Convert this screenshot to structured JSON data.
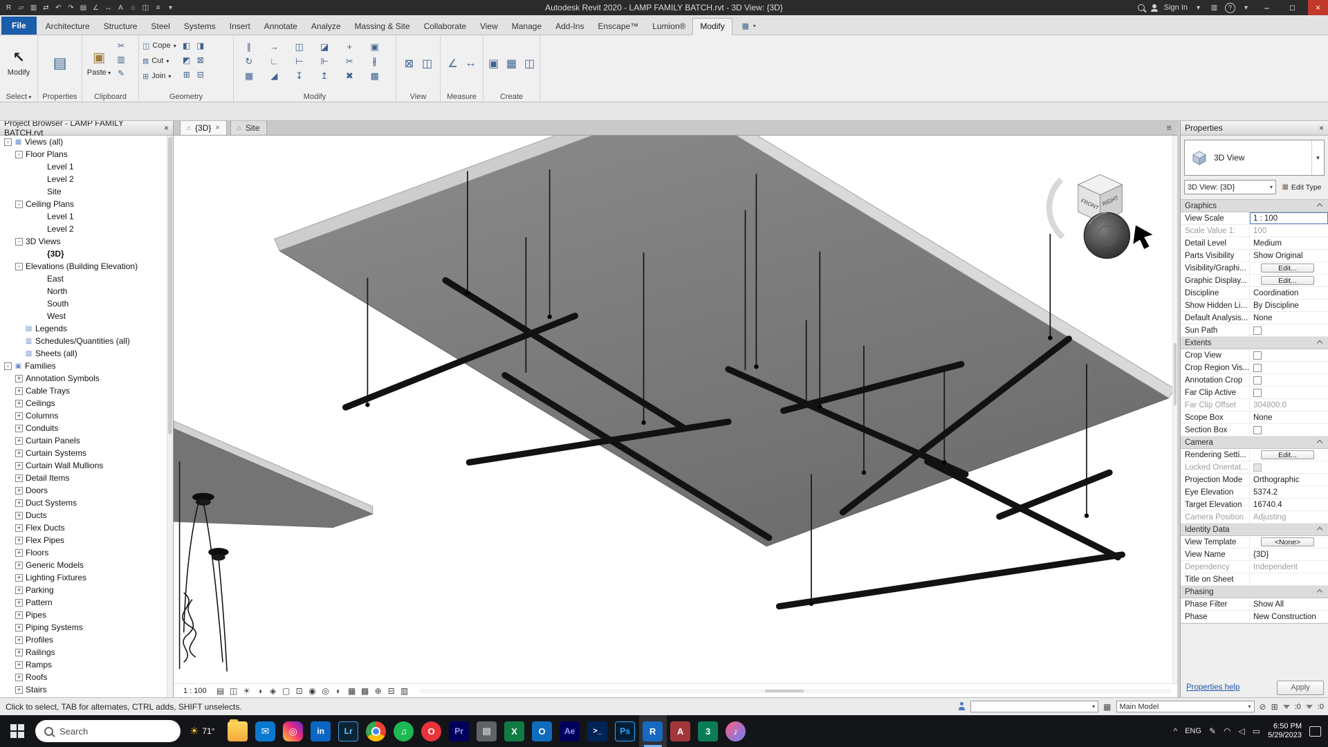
{
  "icons": {
    "caret_down": "▾",
    "caret_up": "^",
    "close": "×",
    "minimize": "–",
    "maximize": "□",
    "help": "?",
    "cursor": "↖",
    "properties_palette": "▤",
    "paste": "▣",
    "panel_image": "▦",
    "sun": "☀",
    "pen": "✎",
    "wifi": "◠",
    "volume": "◁",
    "battery": "▭",
    "list": "≡",
    "store": "▥",
    "tab_view": "⌂",
    "edit_type": "▦",
    "exclude": "⊘",
    "drag": "⊞"
  },
  "title_bar": {
    "title": "Autodesk Revit 2020 - LAMP FAMILY BATCH.rvt - 3D View: {3D}",
    "sign_in": "Sign In",
    "qat": [
      {
        "n": "revit-app-icon",
        "g": "R"
      },
      {
        "n": "open-icon",
        "g": "▱"
      },
      {
        "n": "save-icon",
        "g": "▥"
      },
      {
        "n": "sync-icon",
        "g": "⇄"
      },
      {
        "n": "undo-icon",
        "g": "↶"
      },
      {
        "n": "redo-icon",
        "g": "↷"
      },
      {
        "n": "print-icon",
        "g": "▤"
      },
      {
        "n": "measure-icon",
        "g": "∠"
      },
      {
        "n": "aligned-dimension-icon",
        "g": "↔"
      },
      {
        "n": "text-note-icon",
        "g": "A"
      },
      {
        "n": "default-3d-view-icon",
        "g": "⌂"
      },
      {
        "n": "section-icon",
        "g": "◫"
      },
      {
        "n": "thin-lines-icon",
        "g": "≡"
      },
      {
        "n": "qat-customize-icon",
        "g": "▾"
      }
    ]
  },
  "ribbon": {
    "tabs": [
      {
        "n": "tab-file",
        "label": "File",
        "cls": "file"
      },
      {
        "n": "tab-architecture",
        "label": "Architecture"
      },
      {
        "n": "tab-structure",
        "label": "Structure"
      },
      {
        "n": "tab-steel",
        "label": "Steel"
      },
      {
        "n": "tab-systems",
        "label": "Systems"
      },
      {
        "n": "tab-insert",
        "label": "Insert"
      },
      {
        "n": "tab-annotate",
        "label": "Annotate"
      },
      {
        "n": "tab-analyze",
        "label": "Analyze"
      },
      {
        "n": "tab-massing-site",
        "label": "Massing & Site"
      },
      {
        "n": "tab-collaborate",
        "label": "Collaborate"
      },
      {
        "n": "tab-view",
        "label": "View"
      },
      {
        "n": "tab-manage",
        "label": "Manage"
      },
      {
        "n": "tab-add-ins",
        "label": "Add-Ins"
      },
      {
        "n": "tab-enscape",
        "label": "Enscape™"
      },
      {
        "n": "tab-lumion",
        "label": "Lumion®"
      },
      {
        "n": "tab-modify",
        "label": "Modify",
        "cls": "active"
      }
    ],
    "panel_labels": {
      "select": "Select",
      "properties": "Properties",
      "clipboard": "Clipboard",
      "geometry": "Geometry",
      "modify": "Modify",
      "view": "View",
      "measure": "Measure",
      "create": "Create"
    },
    "big_buttons": {
      "modify": "Modify",
      "paste": "Paste"
    },
    "clipboard_icons": [
      {
        "n": "cut-to-clipboard-icon",
        "g": "✂"
      },
      {
        "n": "copy-to-clipboard-icon",
        "g": "▥"
      },
      {
        "n": "match-type-properties-icon",
        "g": "✎"
      }
    ],
    "geometry_buttons": [
      {
        "n": "cope-button",
        "label": "Cope",
        "g": "◫"
      },
      {
        "n": "cut-geometry-button",
        "label": "Cut",
        "g": "⊠"
      },
      {
        "n": "join-geometry-button",
        "label": "Join",
        "g": "⊞"
      }
    ],
    "geometry_icons": [
      {
        "n": "paint-icon",
        "g": "◧"
      },
      {
        "n": "remove-paint-icon",
        "g": "◨"
      },
      {
        "n": "split-face-icon",
        "g": "◩"
      },
      {
        "n": "demolish-icon",
        "g": "⊠"
      },
      {
        "n": "wall-joins-icon",
        "g": "⊞"
      },
      {
        "n": "beam-joins-icon",
        "g": "⊟"
      }
    ],
    "modify_icons": [
      {
        "n": "align-icon",
        "g": "∥"
      },
      {
        "n": "offset-icon",
        "g": "→"
      },
      {
        "n": "mirror-axis-icon",
        "g": "◫"
      },
      {
        "n": "mirror-pick-icon",
        "g": "◪"
      },
      {
        "n": "move-icon",
        "g": "+"
      },
      {
        "n": "copy-icon",
        "g": "▣"
      },
      {
        "n": "rotate-icon",
        "g": "↻"
      },
      {
        "n": "trim-corner-icon",
        "g": "∟"
      },
      {
        "n": "trim-single-icon",
        "g": "⊢"
      },
      {
        "n": "trim-multiple-icon",
        "g": "⊩"
      },
      {
        "n": "split-element-icon",
        "g": "✂"
      },
      {
        "n": "split-gap-icon",
        "g": "∦"
      },
      {
        "n": "array-icon",
        "g": "▦"
      },
      {
        "n": "scale-icon",
        "g": "◢"
      },
      {
        "n": "pin-icon",
        "g": "↧"
      },
      {
        "n": "unpin-icon",
        "g": "↥"
      },
      {
        "n": "delete-icon",
        "g": "✖"
      },
      {
        "n": "paste-aligned-icon",
        "g": "▩"
      }
    ],
    "view_icons": [
      {
        "n": "close-hidden-windows-icon",
        "g": "⊠"
      },
      {
        "n": "switch-windows-icon",
        "g": "◫"
      }
    ],
    "measure_icons": [
      {
        "n": "measure-length-icon",
        "g": "∠"
      },
      {
        "n": "dimension-icon",
        "g": "↔"
      }
    ],
    "create_icons": [
      {
        "n": "create-group-icon",
        "g": "▣"
      },
      {
        "n": "create-similar-icon",
        "g": "▦"
      },
      {
        "n": "create-assembly-icon",
        "g": "◫"
      }
    ]
  },
  "project_browser": {
    "title": "Project Browser - LAMP FAMILY BATCH.rvt",
    "tree": [
      {
        "label": "Views (all)",
        "cls": "lvl0",
        "exp": "-",
        "ico": "▦"
      },
      {
        "label": "Floor Plans",
        "cls": "lvl1",
        "exp": "-"
      },
      {
        "label": "Level 1",
        "cls": "leaf2"
      },
      {
        "label": "Level 2",
        "cls": "leaf2"
      },
      {
        "label": "Site",
        "cls": "leaf2"
      },
      {
        "label": "Ceiling Plans",
        "cls": "lvl1",
        "exp": "-"
      },
      {
        "label": "Level 1",
        "cls": "leaf2"
      },
      {
        "label": "Level 2",
        "cls": "leaf2"
      },
      {
        "label": "3D Views",
        "cls": "lvl1",
        "exp": "-"
      },
      {
        "label": "{3D}",
        "cls": "leaf2 bold"
      },
      {
        "label": "Elevations (Building Elevation)",
        "cls": "lvl1",
        "exp": "-"
      },
      {
        "label": "East",
        "cls": "leaf2"
      },
      {
        "label": "North",
        "cls": "leaf2"
      },
      {
        "label": "South",
        "cls": "leaf2"
      },
      {
        "label": "West",
        "cls": "leaf2"
      },
      {
        "label": "Legends",
        "cls": "lvl0i",
        "ico": "▤"
      },
      {
        "label": "Schedules/Quantities (all)",
        "cls": "lvl0i",
        "ico": "▥"
      },
      {
        "label": "Sheets (all)",
        "cls": "lvl0i",
        "ico": "▧"
      },
      {
        "label": "Families",
        "cls": "lvl0",
        "exp": "-",
        "ico": "▣"
      },
      {
        "label": "Annotation Symbols",
        "cls": "lvl1",
        "exp": "+"
      },
      {
        "label": "Cable Trays",
        "cls": "lvl1",
        "exp": "+"
      },
      {
        "label": "Ceilings",
        "cls": "lvl1",
        "exp": "+"
      },
      {
        "label": "Columns",
        "cls": "lvl1",
        "exp": "+"
      },
      {
        "label": "Conduits",
        "cls": "lvl1",
        "exp": "+"
      },
      {
        "label": "Curtain Panels",
        "cls": "lvl1",
        "exp": "+"
      },
      {
        "label": "Curtain Systems",
        "cls": "lvl1",
        "exp": "+"
      },
      {
        "label": "Curtain Wall Mullions",
        "cls": "lvl1",
        "exp": "+"
      },
      {
        "label": "Detail Items",
        "cls": "lvl1",
        "exp": "+"
      },
      {
        "label": "Doors",
        "cls": "lvl1",
        "exp": "+"
      },
      {
        "label": "Duct Systems",
        "cls": "lvl1",
        "exp": "+"
      },
      {
        "label": "Ducts",
        "cls": "lvl1",
        "exp": "+"
      },
      {
        "label": "Flex Ducts",
        "cls": "lvl1",
        "exp": "+"
      },
      {
        "label": "Flex Pipes",
        "cls": "lvl1",
        "exp": "+"
      },
      {
        "label": "Floors",
        "cls": "lvl1",
        "exp": "+"
      },
      {
        "label": "Generic Models",
        "cls": "lvl1",
        "exp": "+"
      },
      {
        "label": "Lighting Fixtures",
        "cls": "lvl1",
        "exp": "+"
      },
      {
        "label": "Parking",
        "cls": "lvl1",
        "exp": "+"
      },
      {
        "label": "Pattern",
        "cls": "lvl1",
        "exp": "+"
      },
      {
        "label": "Pipes",
        "cls": "lvl1",
        "exp": "+"
      },
      {
        "label": "Piping Systems",
        "cls": "lvl1",
        "exp": "+"
      },
      {
        "label": "Profiles",
        "cls": "lvl1",
        "exp": "+"
      },
      {
        "label": "Railings",
        "cls": "lvl1",
        "exp": "+"
      },
      {
        "label": "Ramps",
        "cls": "lvl1",
        "exp": "+"
      },
      {
        "label": "Roofs",
        "cls": "lvl1",
        "exp": "+"
      },
      {
        "label": "Stairs",
        "cls": "lvl1",
        "exp": "+"
      }
    ]
  },
  "view_tabs": [
    {
      "n": "view-tab-3d",
      "label": "{3D}",
      "cls": "active"
    },
    {
      "n": "view-tab-site",
      "label": "Site"
    }
  ],
  "viewport": {
    "scale": "1 : 100",
    "viewcube": {
      "front": "FRONT",
      "right": "RIGHT"
    },
    "control_icons": [
      {
        "n": "detail-level-icon",
        "g": "▤"
      },
      {
        "n": "visual-style-icon",
        "g": "◫"
      },
      {
        "n": "sun-path-icon",
        "g": "☀"
      },
      {
        "n": "shadows-icon",
        "g": "◑"
      },
      {
        "n": "rendering-dialog-icon",
        "g": "◈"
      },
      {
        "n": "crop-view-icon",
        "g": "▢"
      },
      {
        "n": "show-crop-region-icon",
        "g": "⊡"
      },
      {
        "n": "unlocked-view-icon",
        "g": "◉"
      },
      {
        "n": "temporary-hide-isolate-icon",
        "g": "◎"
      },
      {
        "n": "reveal-hidden-elements-icon",
        "g": "◐"
      },
      {
        "n": "temporary-view-properties-icon",
        "g": "▦"
      },
      {
        "n": "analytical-model-icon",
        "g": "▩"
      },
      {
        "n": "highlight-displacement-icon",
        "g": "⊕"
      },
      {
        "n": "reveal-constraints-icon",
        "g": "⊟"
      },
      {
        "n": "worksharing-display-icon",
        "g": "▥"
      }
    ]
  },
  "properties_panel": {
    "title": "Properties",
    "type_selector": "3D View",
    "instance_selector": "3D View: {3D}",
    "edit_type": "Edit Type",
    "rows": [
      {
        "label": "Graphics",
        "cls": "head"
      },
      {
        "label": "View Scale",
        "value": "1 : 100",
        "vcls": "sel"
      },
      {
        "label": "Scale Value  1:",
        "value": "100",
        "cls": "dim",
        "vcls": "gray"
      },
      {
        "label": "Detail Level",
        "value": "Medium"
      },
      {
        "label": "Parts Visibility",
        "value": "Show Original"
      },
      {
        "label": "Visibility/Graphi...",
        "value": "Edit...",
        "vcls": "btn"
      },
      {
        "label": "Graphic Display...",
        "value": "Edit...",
        "vcls": "btn"
      },
      {
        "label": "Discipline",
        "value": "Coordination"
      },
      {
        "label": "Show Hidden Li...",
        "value": "By Discipline"
      },
      {
        "label": "Default Analysis...",
        "value": "None"
      },
      {
        "label": "Sun Path",
        "value": "",
        "vcls": "chk"
      },
      {
        "label": "Extents",
        "cls": "head"
      },
      {
        "label": "Crop View",
        "value": "",
        "vcls": "chk"
      },
      {
        "label": "Crop Region Vis...",
        "value": "",
        "vcls": "chk"
      },
      {
        "label": "Annotation Crop",
        "value": "",
        "vcls": "chk"
      },
      {
        "label": "Far Clip Active",
        "value": "",
        "vcls": "chk"
      },
      {
        "label": "Far Clip Offset",
        "value": "304800.0",
        "cls": "dim",
        "vcls": "gray"
      },
      {
        "label": "Scope Box",
        "value": "None"
      },
      {
        "label": "Section Box",
        "value": "",
        "vcls": "chk"
      },
      {
        "label": "Camera",
        "cls": "head"
      },
      {
        "label": "Rendering Setti...",
        "value": "Edit...",
        "vcls": "btn"
      },
      {
        "label": "Locked Orientat...",
        "value": "",
        "cls": "dim",
        "vcls": "chkd"
      },
      {
        "label": "Projection Mode",
        "value": "Orthographic"
      },
      {
        "label": "Eye Elevation",
        "value": "5374.2"
      },
      {
        "label": "Target Elevation",
        "value": "16740.4"
      },
      {
        "label": "Camera Position",
        "value": "Adjusting",
        "cls": "dim",
        "vcls": "gray"
      },
      {
        "label": "Identity Data",
        "cls": "head"
      },
      {
        "label": "View Template",
        "value": "<None>",
        "vcls": "btn"
      },
      {
        "label": "View Name",
        "value": "{3D}"
      },
      {
        "label": "Dependency",
        "value": "Independent",
        "cls": "dim",
        "vcls": "gray"
      },
      {
        "label": "Title on Sheet",
        "value": ""
      },
      {
        "label": "Phasing",
        "cls": "head"
      },
      {
        "label": "Phase Filter",
        "value": "Show All"
      },
      {
        "label": "Phase",
        "value": "New Construction"
      }
    ],
    "help": "Properties help",
    "apply": "Apply"
  },
  "status_bar": {
    "hint": "Click to select, TAB for alternates, CTRL adds, SHIFT unselects.",
    "main_model": "Main Model",
    "count": ":0",
    "count2": ":0"
  },
  "taskbar": {
    "search_placeholder": "Search",
    "temperature": "71°",
    "lang": "ENG",
    "time": "6:50 PM",
    "date": "5/29/2023",
    "apps": [
      {
        "n": "file-explorer-icon",
        "cls": "a-folder",
        "g": ""
      },
      {
        "n": "mail-icon",
        "cls": "a-mail",
        "g": "✉"
      },
      {
        "n": "instagram-icon",
        "cls": "a-insta",
        "g": "◎"
      },
      {
        "n": "linkedin-icon",
        "cls": "a-li",
        "g": "in"
      },
      {
        "n": "lightroom-icon",
        "cls": "a-lr",
        "g": "Lr"
      },
      {
        "n": "chrome-icon",
        "cls": "a-chrome",
        "g": ""
      },
      {
        "n": "spotify-icon",
        "cls": "a-spotify",
        "g": "♫"
      },
      {
        "n": "opera-icon",
        "cls": "a-opera",
        "g": "O"
      },
      {
        "n": "premiere-icon",
        "cls": "a-pr",
        "g": "Pr"
      },
      {
        "n": "notepad-icon",
        "cls": "a-note",
        "g": "▤"
      },
      {
        "n": "excel-icon",
        "cls": "a-excel",
        "g": "X"
      },
      {
        "n": "outlook-icon",
        "cls": "a-outlook",
        "g": "O"
      },
      {
        "n": "after-effects-icon",
        "cls": "a-ae",
        "g": "Ae"
      },
      {
        "n": "powershell-icon",
        "cls": "a-ps1",
        "g": ">_"
      },
      {
        "n": "photoshop-icon",
        "cls": "a-pshop",
        "g": "Ps"
      },
      {
        "n": "revit-icon",
        "cls": "a-revit active",
        "g": "R"
      },
      {
        "n": "access-icon",
        "cls": "a-access",
        "g": "A"
      },
      {
        "n": "3ds-max-icon",
        "cls": "a-max",
        "g": "3"
      },
      {
        "n": "music-app-icon",
        "cls": "a-music",
        "g": "♪"
      }
    ]
  }
}
